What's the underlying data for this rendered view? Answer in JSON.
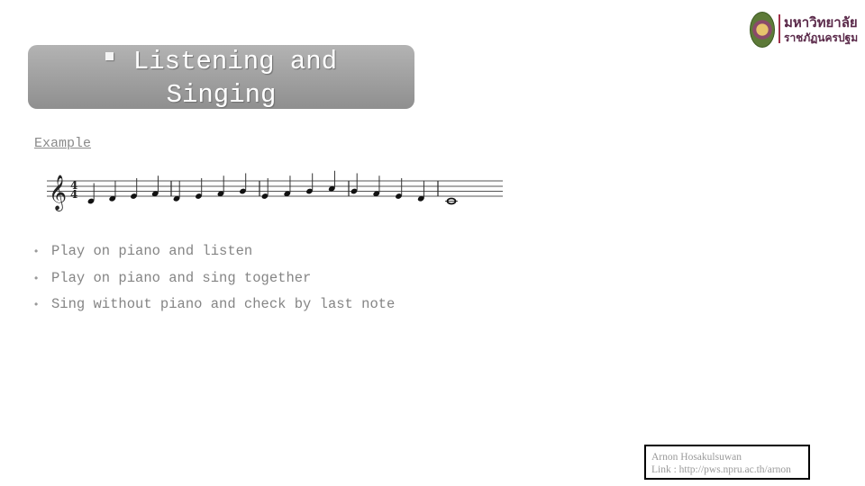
{
  "header": {
    "title_line1": "Listening and",
    "title_line2": "Singing",
    "bullet_icon": "square-bullet"
  },
  "logo": {
    "emblem": "university-emblem-icon",
    "name_line1": "มหาวิทยาลัย",
    "name_line2": "ราชภัฏนครปฐม"
  },
  "example": {
    "label": "Example",
    "music": {
      "clef": "treble",
      "time_signature": "4/4",
      "measures": [
        {
          "notes": [
            "C4",
            "D4",
            "E4",
            "F4"
          ],
          "duration": "quarter"
        },
        {
          "notes": [
            "D4",
            "E4",
            "F4",
            "G4"
          ],
          "duration": "quarter"
        },
        {
          "notes": [
            "E4",
            "F4",
            "G4",
            "A4"
          ],
          "duration": "quarter"
        },
        {
          "notes": [
            "G4",
            "F4",
            "E4",
            "D4"
          ],
          "duration": "quarter"
        },
        {
          "notes": [
            "C4"
          ],
          "duration": "whole"
        }
      ]
    }
  },
  "instructions": [
    "Play on piano and listen",
    "Play on piano and sing together",
    "Sing without piano and check by last note"
  ],
  "credit": {
    "author": "Arnon Hosakulsuwan",
    "link": "Link : http://pws.npru.ac.th/arnon"
  }
}
